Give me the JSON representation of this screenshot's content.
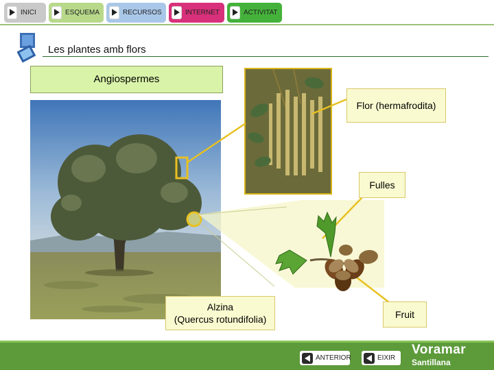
{
  "nav": {
    "inici": "INICI",
    "esquema": "ESQUEMA",
    "recursos": "RECURSOS",
    "internet": "INTERNET",
    "activitat": "ACTIVITAT"
  },
  "title": "Les plantes amb flors",
  "labels": {
    "angiospermes": "Angiospermes",
    "flor": "Flor (hermafrodita)",
    "fulles": "Fulles",
    "alzina_name": "Alzina",
    "alzina_scientific": "(Quercus rotundifolia)",
    "fruit": "Fruit"
  },
  "footer": {
    "anterior": "ANTERIOR",
    "eixir": "EIXIR",
    "brand_main": "Voramar",
    "brand_sub": "Santillana"
  },
  "colors": {
    "accent_green": "#5c9a3a",
    "label_fill": "#fafad0",
    "highlight_yellow": "#e8c020",
    "internet_pink": "#d8307a",
    "activitat_green": "#44b23a"
  }
}
